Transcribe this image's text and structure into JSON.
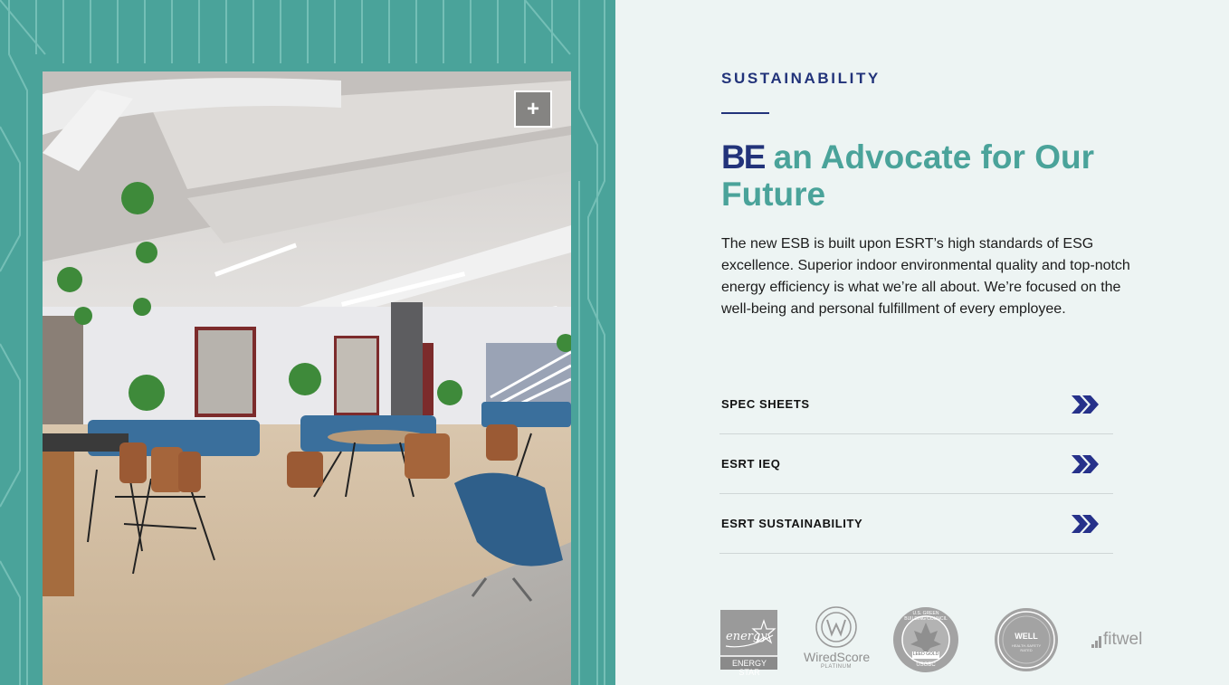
{
  "photo": {
    "expand_label": "+"
  },
  "section": {
    "eyebrow": "SUSTAINABILITY",
    "headline_emphasis": "BE",
    "headline_rest": " an Advocate for Our Future",
    "body": "The new ESB is built upon ESRT’s high standards of ESG excellence. Superior indoor environmental quality and top-notch energy efficiency is what we’re all about. We’re focused on the well-being and personal fulfillment of every employee."
  },
  "links": [
    {
      "label": "SPEC SHEETS",
      "icon": "double-chevron-right-icon"
    },
    {
      "label": "ESRT IEQ",
      "icon": "double-chevron-right-icon"
    },
    {
      "label": "ESRT SUSTAINABILITY",
      "icon": "double-chevron-right-icon"
    }
  ],
  "logos": {
    "energy_star": {
      "script": "energy",
      "caption": "ENERGY STAR"
    },
    "wiredscore": {
      "name": "WiredScore",
      "tier": "PLATINUM"
    },
    "usgbc": {
      "ring": "U.S. GREEN BUILDING COUNCIL",
      "tier": "LEED GOLD",
      "org": "USGBC"
    },
    "well": {
      "name": "WELL",
      "sub": "HEALTH-SAFETY RATED"
    },
    "fitwel": {
      "name": "fitwel"
    }
  },
  "colors": {
    "teal": "#4aa39a",
    "navy": "#22337a",
    "background": "#edf4f3",
    "chevron": "#26318a"
  }
}
